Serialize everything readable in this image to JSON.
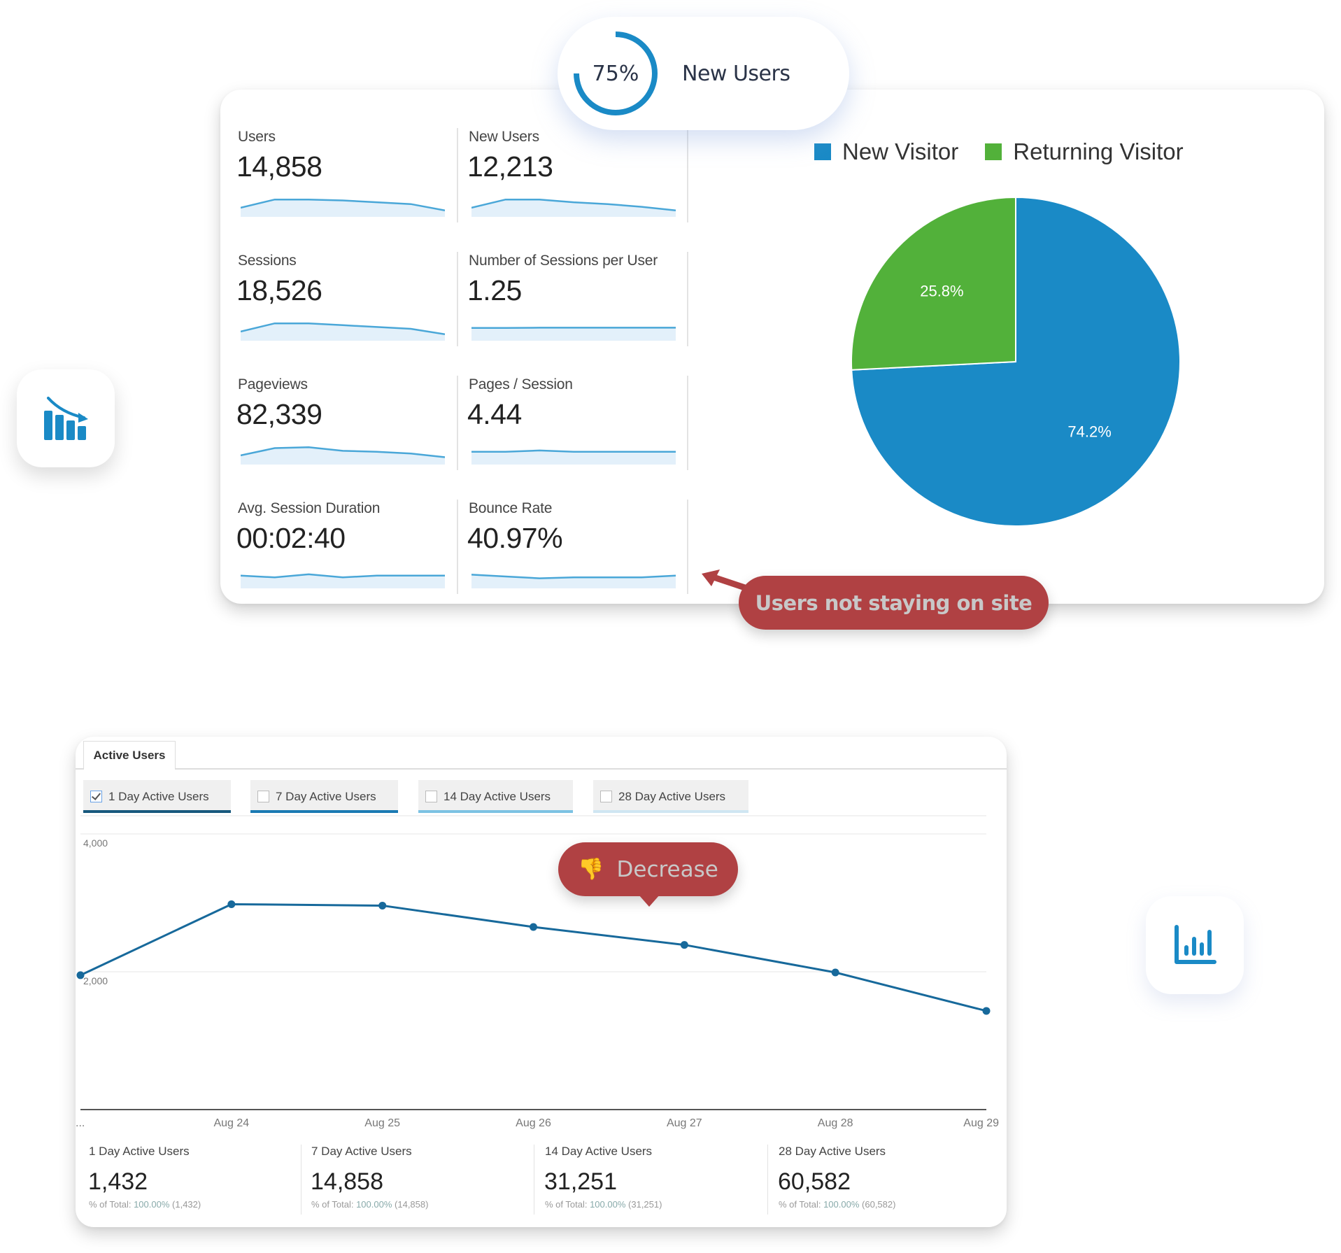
{
  "pill": {
    "percent_label": "75%",
    "percent_value": 75,
    "label": "New Users",
    "ring_color": "#1a8ac6"
  },
  "overview": {
    "metrics": [
      {
        "label": "Users",
        "value": "14,858",
        "trend": [
          0.35,
          0.8,
          0.8,
          0.75,
          0.65,
          0.55,
          0.2
        ]
      },
      {
        "label": "New Users",
        "value": "12,213",
        "trend": [
          0.35,
          0.8,
          0.8,
          0.65,
          0.55,
          0.4,
          0.2
        ]
      },
      {
        "label": "Sessions",
        "value": "18,526",
        "trend": [
          0.35,
          0.8,
          0.8,
          0.7,
          0.6,
          0.5,
          0.2
        ]
      },
      {
        "label": "Number of Sessions per User",
        "value": "1.25",
        "trend": [
          0.55,
          0.55,
          0.56,
          0.56,
          0.56,
          0.56,
          0.56
        ]
      },
      {
        "label": "Pageviews",
        "value": "82,339",
        "trend": [
          0.35,
          0.75,
          0.8,
          0.6,
          0.55,
          0.45,
          0.25
        ]
      },
      {
        "label": "Pages / Session",
        "value": "4.44",
        "trend": [
          0.55,
          0.55,
          0.62,
          0.55,
          0.55,
          0.55,
          0.55
        ]
      },
      {
        "label": "Avg. Session Duration",
        "value": "00:02:40",
        "trend": [
          0.55,
          0.45,
          0.62,
          0.45,
          0.55,
          0.55,
          0.55
        ]
      },
      {
        "label": "Bounce Rate",
        "value": "40.97%",
        "trend": [
          0.6,
          0.5,
          0.4,
          0.45,
          0.45,
          0.45,
          0.55
        ]
      }
    ],
    "sparkline_color": "#4aa7d8",
    "sparkline_fill": "#e3f0fa"
  },
  "callouts": {
    "users_not_staying": "Users not staying on site",
    "decrease": "Decrease",
    "decrease_icon": "thumbs-down-icon",
    "color": "#b04143"
  },
  "icons": {
    "left_card": "declining-bar-chart-icon",
    "right_card": "bar-chart-icon",
    "color": "#1a8ac6"
  },
  "active_users": {
    "tab_label": "Active Users",
    "toggles": [
      {
        "label": "1 Day Active Users",
        "checked": true,
        "bar_color": "#17587d"
      },
      {
        "label": "7 Day Active Users",
        "checked": false,
        "bar_color": "#1a7ab3"
      },
      {
        "label": "14 Day Active Users",
        "checked": false,
        "bar_color": "#7cc2e3"
      },
      {
        "label": "28 Day Active Users",
        "checked": false,
        "bar_color": "#cfe6f2"
      }
    ],
    "summary": [
      {
        "label": "1 Day Active Users",
        "value": "1,432",
        "pct_prefix": "% of Total: ",
        "pct": "100.00%",
        "total": "(1,432)"
      },
      {
        "label": "7 Day Active Users",
        "value": "14,858",
        "pct_prefix": "% of Total: ",
        "pct": "100.00%",
        "total": "(14,858)"
      },
      {
        "label": "14 Day Active Users",
        "value": "31,251",
        "pct_prefix": "% of Total: ",
        "pct": "100.00%",
        "total": "(31,251)"
      },
      {
        "label": "28 Day Active Users",
        "value": "60,582",
        "pct_prefix": "% of Total: ",
        "pct": "100.00%",
        "total": "(60,582)"
      }
    ]
  },
  "chart_data": [
    {
      "type": "pie",
      "title": "",
      "legend_position": "top",
      "slices": [
        {
          "name": "New Visitor",
          "value": 74.2,
          "label": "74.2%",
          "color": "#1a8ac6"
        },
        {
          "name": "Returning Visitor",
          "value": 25.8,
          "label": "25.8%",
          "color": "#52b13a"
        }
      ]
    },
    {
      "type": "line",
      "title": "",
      "series": [
        {
          "name": "1 Day Active Users",
          "values": [
            1950,
            2980,
            2960,
            2650,
            2390,
            1990,
            1432
          ],
          "color": "#17699b"
        }
      ],
      "x": [
        "...",
        "Aug 24",
        "Aug 25",
        "Aug 26",
        "Aug 27",
        "Aug 28",
        "Aug 29"
      ],
      "yticks": [
        {
          "value": 4000,
          "label": "4,000"
        },
        {
          "value": 2000,
          "label": "2,000"
        }
      ],
      "ylim": [
        0,
        4000
      ],
      "grid": true,
      "xlabel": "",
      "ylabel": ""
    }
  ]
}
